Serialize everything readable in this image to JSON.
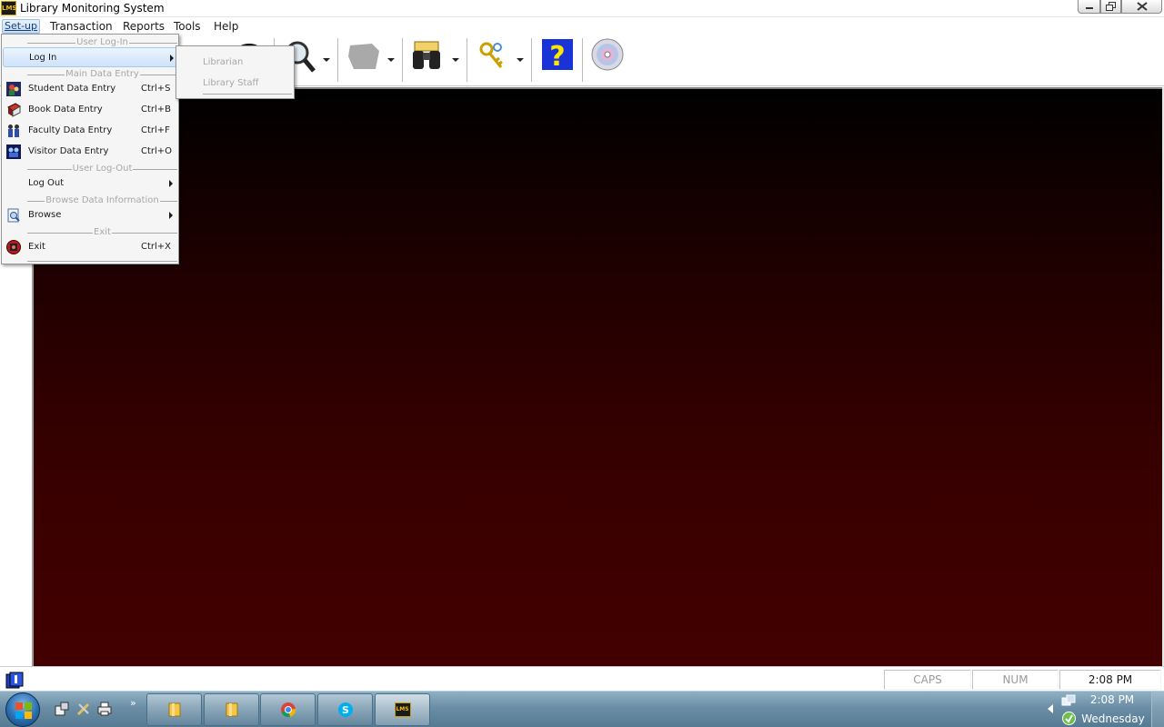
{
  "window": {
    "title": "Library Monitoring System",
    "app_icon_text": "LMS"
  },
  "menubar": [
    "Set-up",
    "Transaction",
    "Reports",
    "Tools",
    "Help"
  ],
  "setup_menu": {
    "sep_user_login": "User Log-In",
    "login": "Log In",
    "sep_main_data_entry": "Main Data Entry",
    "student": {
      "label": "Student Data Entry",
      "shortcut": "Ctrl+S"
    },
    "book": {
      "label": "Book Data Entry",
      "shortcut": "Ctrl+B"
    },
    "faculty": {
      "label": "Faculty Data Entry",
      "shortcut": "Ctrl+F"
    },
    "visitor": {
      "label": "Visitor Data Entry",
      "shortcut": "Ctrl+O"
    },
    "sep_user_logout": "User Log-Out",
    "logout": "Log Out",
    "sep_browse": "Browse Data Information",
    "browse": "Browse",
    "sep_exit": "Exit",
    "exit": {
      "label": "Exit",
      "shortcut": "Ctrl+X"
    }
  },
  "login_submenu": [
    "Librarian",
    "Library Staff"
  ],
  "statusbar": {
    "caps": "CAPS",
    "num": "NUM",
    "time": "2:08 PM"
  },
  "taskbar": {
    "clock_time": "2:08 PM",
    "clock_day": "Wednesday",
    "quicklaunch_more": "»",
    "lms_button_text": "LMS"
  },
  "colors": {
    "workspace_top": "#000000",
    "workspace_bottom": "#430000",
    "menu_highlight": "#cfe3f8"
  }
}
